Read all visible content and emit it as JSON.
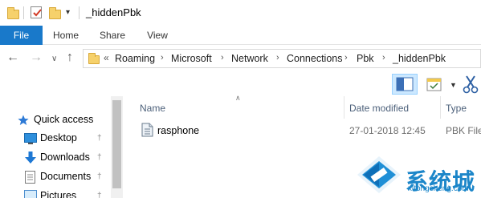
{
  "window": {
    "title": "_hiddenPbk"
  },
  "ribbon": {
    "tabs": [
      "File",
      "Home",
      "Share",
      "View"
    ]
  },
  "address": {
    "overflow": "«",
    "crumbs": [
      "Roaming",
      "Microsoft",
      "Network",
      "Connections",
      "Pbk",
      "_hiddenPbk"
    ]
  },
  "navpane": {
    "items": [
      {
        "label": "Quick access",
        "icon": "star-icon"
      },
      {
        "label": "Desktop",
        "icon": "desktop-icon",
        "pinned": true
      },
      {
        "label": "Downloads",
        "icon": "download-arrow-icon",
        "pinned": true
      },
      {
        "label": "Documents",
        "icon": "documents-icon",
        "pinned": true
      },
      {
        "label": "Pictures",
        "icon": "pictures-icon",
        "pinned": true
      }
    ]
  },
  "filelist": {
    "columns": [
      "Name",
      "Date modified",
      "Type"
    ],
    "rows": [
      {
        "name": "rasphone",
        "date": "27-01-2018 12:45",
        "type": "PBK File",
        "icon": "pbk-file-icon"
      }
    ]
  },
  "watermark": {
    "title": "系统城",
    "domain": "xitongcheng.com"
  },
  "colors": {
    "file_tab": "#1979ca",
    "watermark": "#1c86c9",
    "selected_view": "#cce8ff"
  }
}
